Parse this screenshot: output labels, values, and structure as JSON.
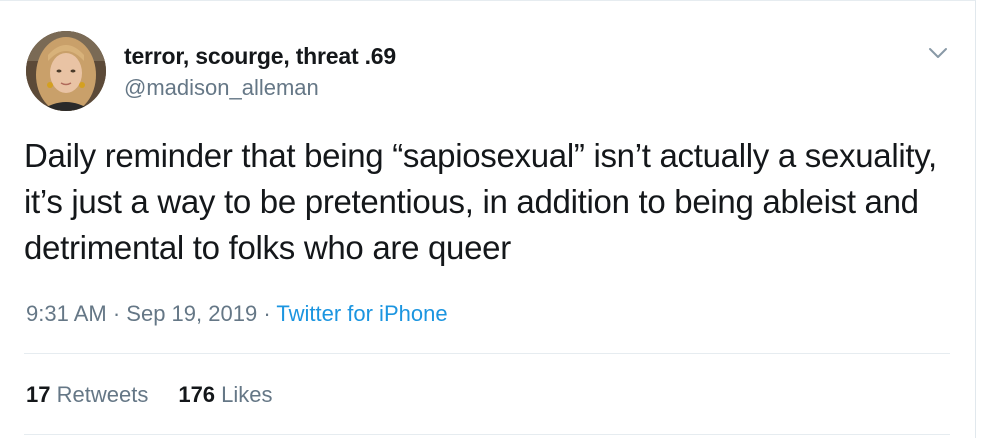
{
  "user": {
    "display_name": "terror, scourge, threat .69",
    "handle": "@madison_alleman",
    "avatar_icon": "profile-photo"
  },
  "tweet": {
    "text": "Daily reminder that being “sapiosexual” isn’t actually a sexuality, it’s just a way to be pretentious, in addition to being ableist and detrimental to folks who are queer",
    "time": "9:31 AM",
    "date": "Sep 19, 2019",
    "separator": "·",
    "source": "Twitter for iPhone"
  },
  "stats": {
    "retweets_count": "17",
    "retweets_label": "Retweets",
    "likes_count": "176",
    "likes_label": "Likes"
  },
  "colors": {
    "link": "#1b95e0",
    "secondary_text": "#657786",
    "primary_text": "#14171a",
    "divider": "#e6ecf0"
  },
  "icons": {
    "menu": "chevron-down-icon"
  }
}
